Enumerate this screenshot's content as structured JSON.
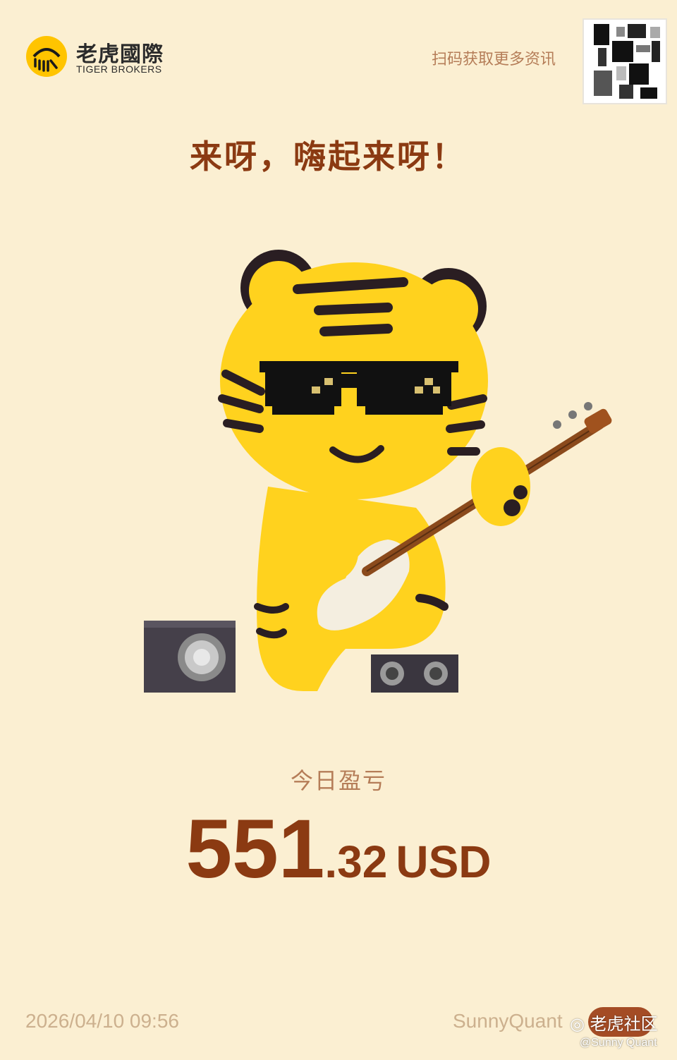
{
  "brand": {
    "name_cn": "老虎國際",
    "name_en": "TIGER BROKERS",
    "logo_color": "#FFC400"
  },
  "header": {
    "scan_prompt": "扫码获取更多资讯",
    "qr_icon": "qr-code-icon"
  },
  "headline": "来呀，嗨起来呀！",
  "illustration": {
    "subject": "tiger-mascot-with-guitar-icon"
  },
  "pnl": {
    "label": "今日盈亏",
    "integer_part": "551",
    "decimal_part": ".32",
    "currency": "USD"
  },
  "footer": {
    "timestamp": "2026/04/10 09:56",
    "username": "SunnyQuant"
  },
  "watermark": {
    "community": "◎ 老虎社区",
    "handle": "@Sunny Quant"
  },
  "colors": {
    "background": "#FBEFD2",
    "accent": "#8B3A12",
    "muted": "#B57D58",
    "mascot_yellow": "#FFD21E"
  }
}
